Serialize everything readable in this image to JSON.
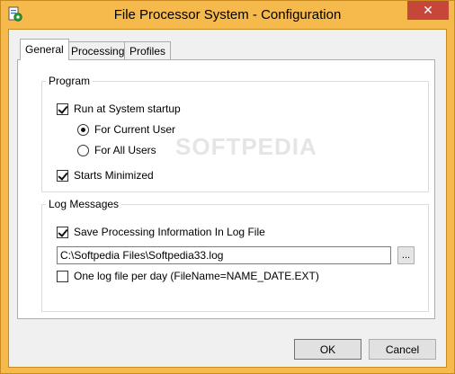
{
  "window": {
    "title": "File Processor System - Configuration",
    "close_glyph": "✕"
  },
  "tabs": [
    {
      "label": "General",
      "active": true
    },
    {
      "label": "Processing",
      "active": false
    },
    {
      "label": "Profiles",
      "active": false
    }
  ],
  "program": {
    "group_label": "Program",
    "run_at_startup": {
      "label": "Run at System startup",
      "checked": true
    },
    "for_current_user": {
      "label": "For Current User",
      "selected": true
    },
    "for_all_users": {
      "label": "For All Users",
      "selected": false
    },
    "starts_minimized": {
      "label": "Starts Minimized",
      "checked": true
    }
  },
  "log_messages": {
    "group_label": "Log Messages",
    "save_processing_info": {
      "label": "Save Processing Information In Log File",
      "checked": true
    },
    "log_path": "C:\\Softpedia Files\\Softpedia33.log",
    "browse_label": "...",
    "one_log_per_day": {
      "label": "One log file per day  (FileName=NAME_DATE.EXT)",
      "checked": false
    }
  },
  "buttons": {
    "ok": "OK",
    "cancel": "Cancel"
  },
  "watermark": "SOFTPEDIA",
  "colors": {
    "title_bar": "#f6b94c",
    "close_button": "#c7463a"
  }
}
